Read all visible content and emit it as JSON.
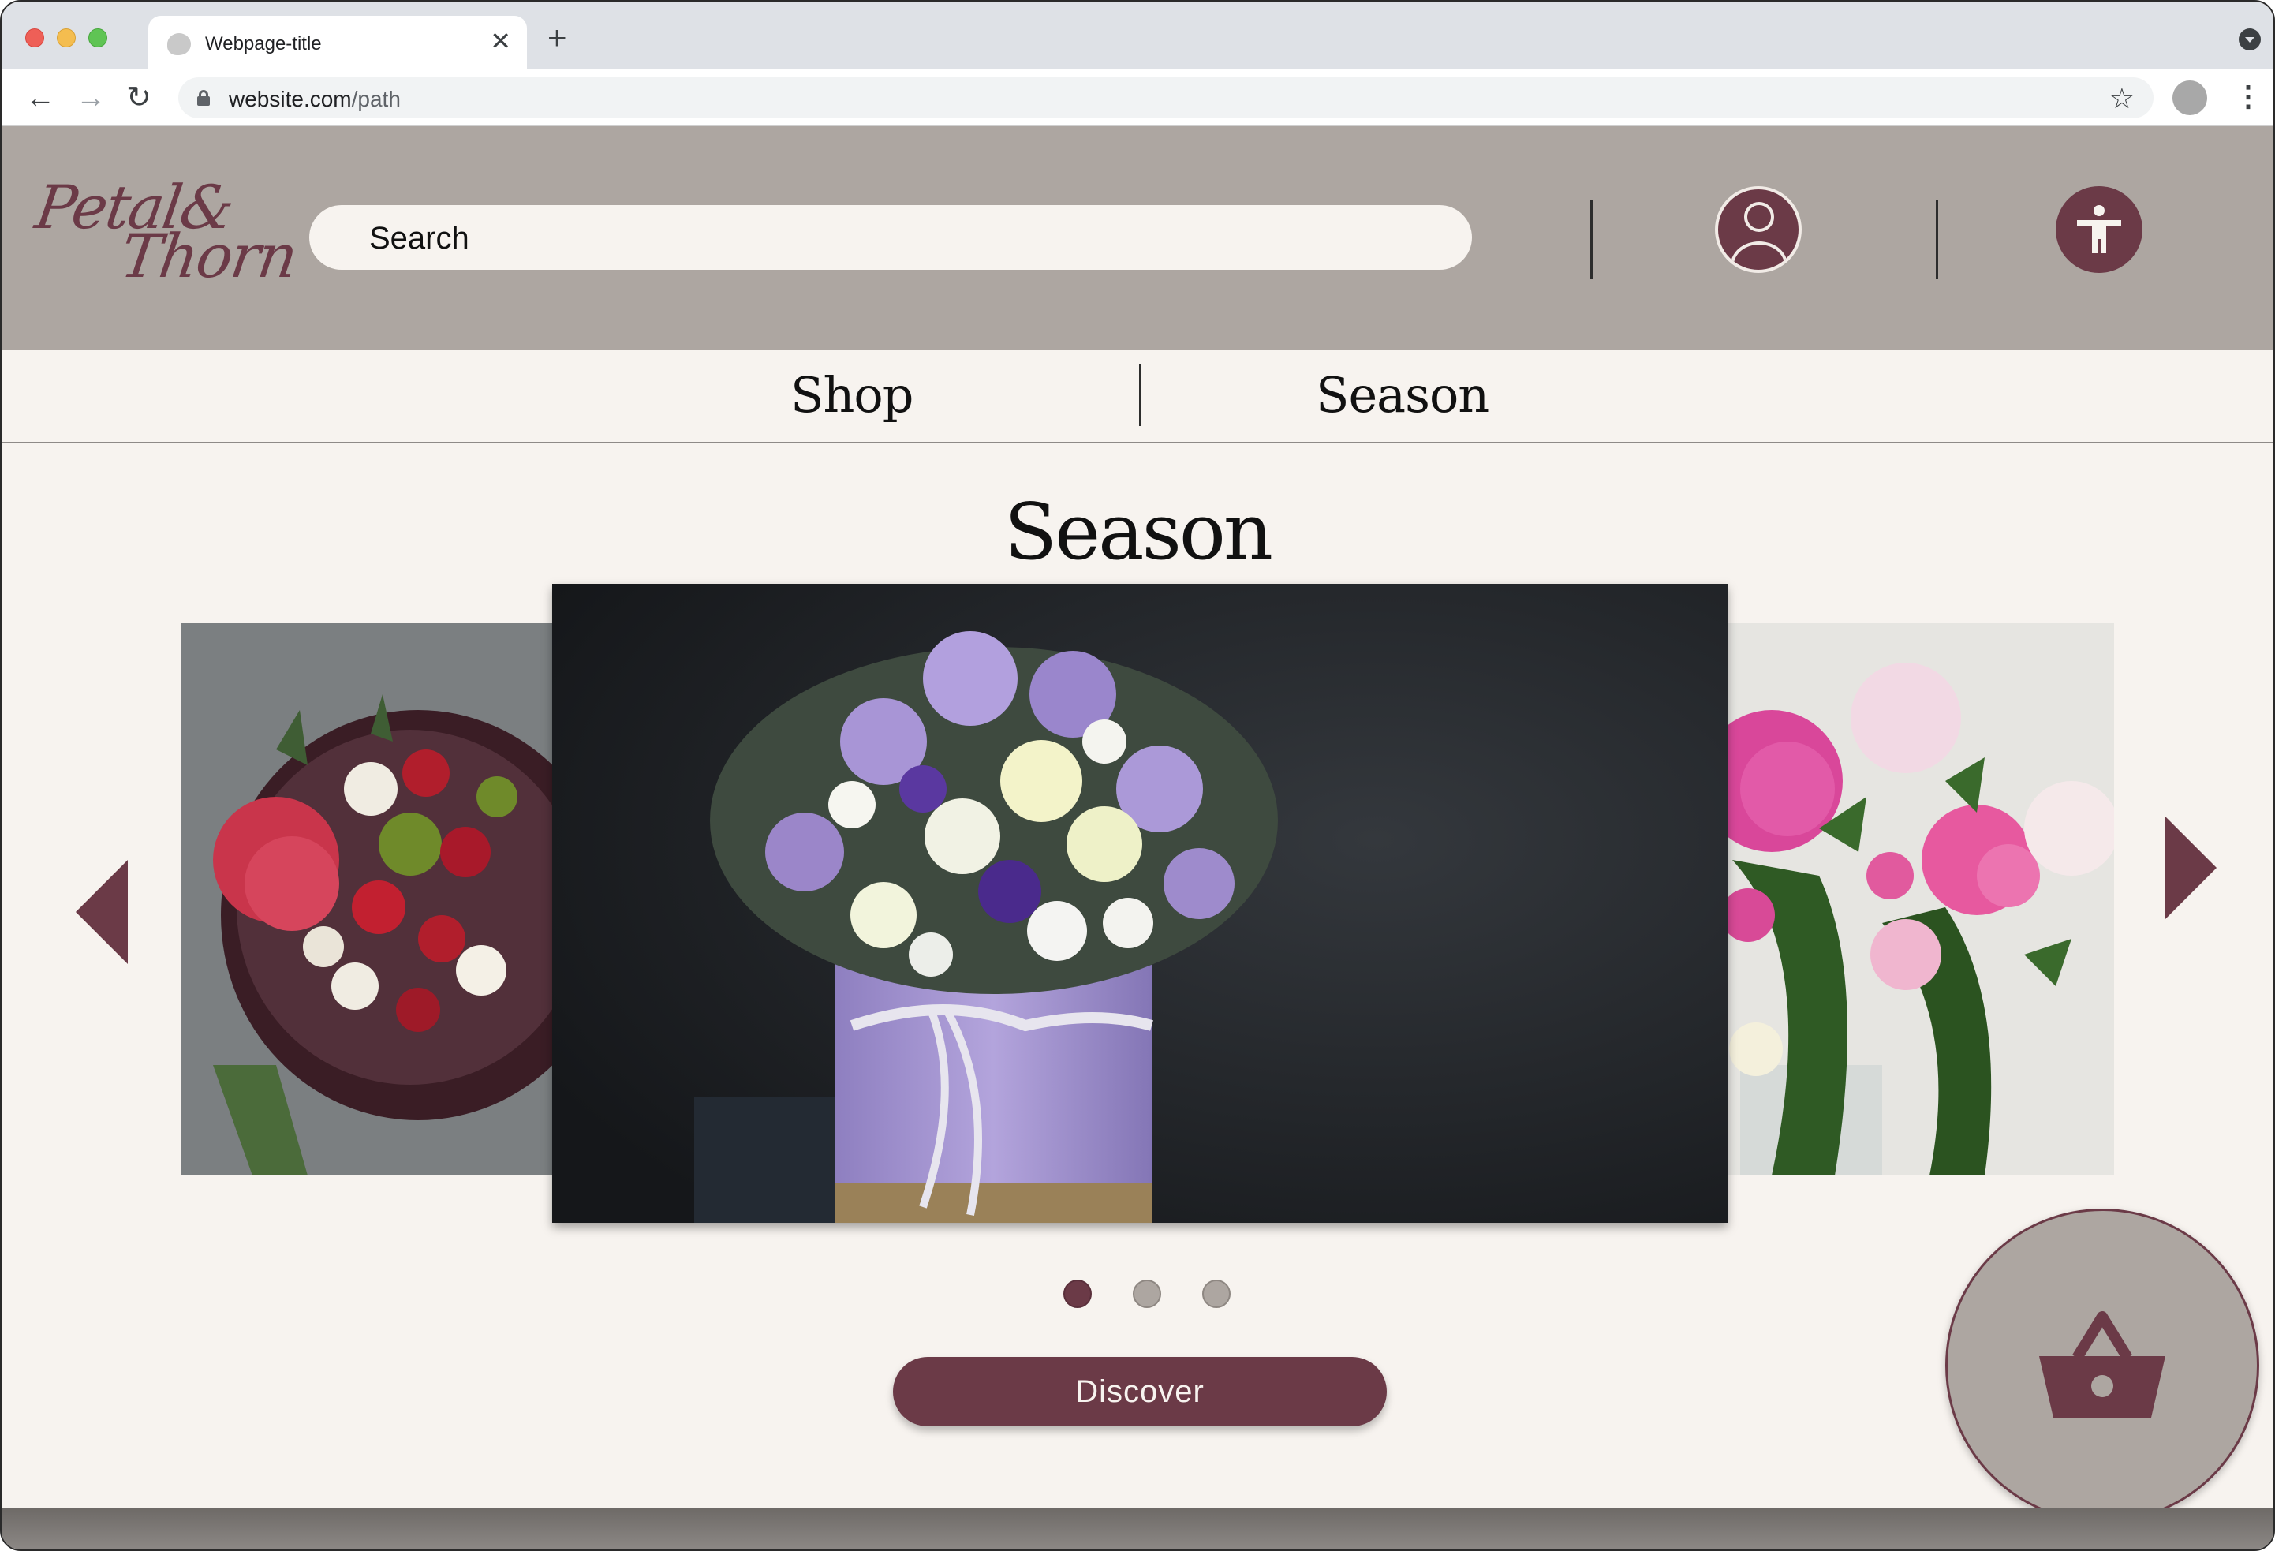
{
  "browser": {
    "tab_title": "Webpage-title",
    "tab_close": "✕",
    "new_tab": "+",
    "url_domain": "website.com",
    "url_path": "/path",
    "back": "←",
    "forward": "→",
    "reload": "↻",
    "bookmark": "☆",
    "menu": "⋮"
  },
  "header": {
    "logo_line1": "Petal&",
    "logo_line2": "Thorn",
    "search_placeholder": "Search"
  },
  "nav": {
    "items": [
      {
        "label": "Shop"
      },
      {
        "label": "Season"
      }
    ]
  },
  "main": {
    "title": "Season",
    "carousel": {
      "slides": [
        {
          "icon": "red-bouquet-image"
        },
        {
          "icon": "lavender-hatbox-bouquet-image"
        },
        {
          "icon": "pink-peonies-image"
        }
      ],
      "active_index": 0,
      "dot_count": 3
    },
    "discover_label": "Discover"
  },
  "colors": {
    "brand": "#6b3a47",
    "header_bg": "#ada6a1",
    "page_bg": "#f7f3ef"
  }
}
